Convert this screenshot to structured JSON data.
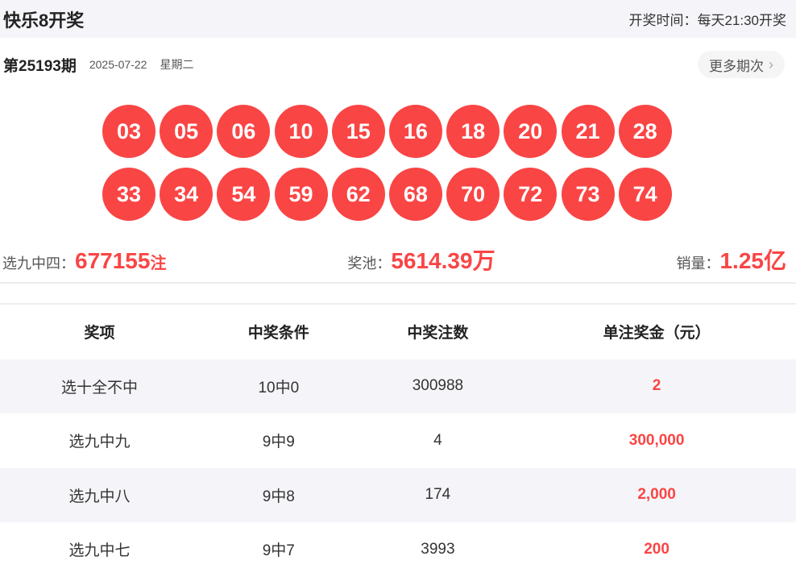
{
  "header": {
    "title": "快乐8开奖",
    "draw_time": "开奖时间：每天21:30开奖"
  },
  "issue": {
    "number": "第25193期",
    "date": "2025-07-22",
    "weekday": "星期二",
    "more_label": "更多期次"
  },
  "balls": [
    "03",
    "05",
    "06",
    "10",
    "15",
    "16",
    "18",
    "20",
    "21",
    "28",
    "33",
    "34",
    "54",
    "59",
    "62",
    "68",
    "70",
    "72",
    "73",
    "74"
  ],
  "stats": {
    "x94_label": "选九中四：",
    "x94_value": "677155",
    "x94_unit": "注",
    "pool_label": "奖池：",
    "pool_value": "5614.39",
    "pool_unit": "万",
    "sales_label": "销量：",
    "sales_value": "1.25",
    "sales_unit": "亿"
  },
  "table": {
    "headers": [
      "奖项",
      "中奖条件",
      "中奖注数",
      "单注奖金（元）"
    ],
    "rows": [
      [
        "选十全不中",
        "10中0",
        "300988",
        "2"
      ],
      [
        "选九中九",
        "9中9",
        "4",
        "300,000"
      ],
      [
        "选九中八",
        "9中8",
        "174",
        "2,000"
      ],
      [
        "选九中七",
        "9中7",
        "3993",
        "200"
      ]
    ]
  }
}
